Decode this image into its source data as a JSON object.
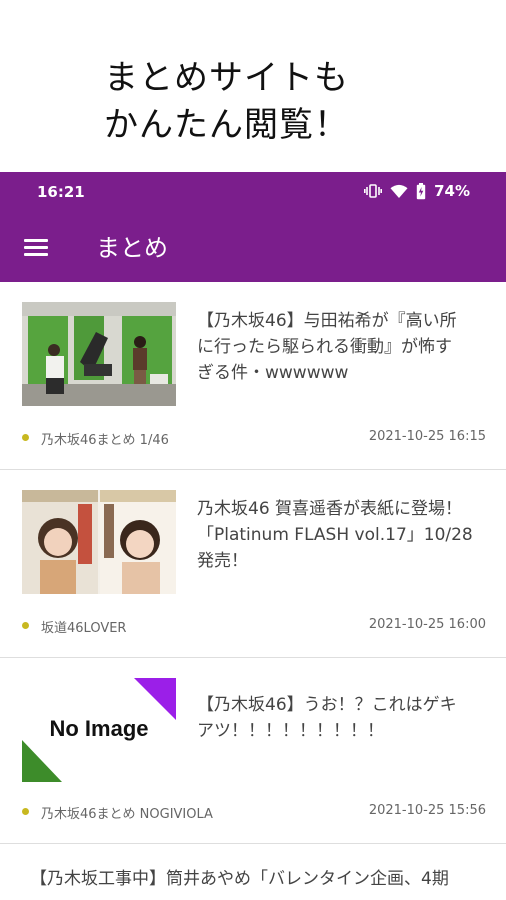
{
  "promo": {
    "line1": "まとめサイトも",
    "line2": "かんたん閲覧！"
  },
  "status_bar": {
    "time": "16:21",
    "battery": "74%",
    "icons": [
      "vibrate-icon",
      "wifi-icon",
      "battery-charging-icon"
    ]
  },
  "app_bar": {
    "title": "まとめ",
    "menu_icon": "hamburger-menu-icon"
  },
  "colors": {
    "primary": "#7b1e8c",
    "source_dot": "#c8b820"
  },
  "articles": [
    {
      "title_lines": [
        "【乃木坂46】与田祐希が『高い所",
        "に行ったら駆られる衝動』が怖す",
        "ぎる件・wwwwww"
      ],
      "source": "乃木坂46まとめ 1/46",
      "timestamp": "2021-10-25 16:15",
      "thumbnail": "photo"
    },
    {
      "title_lines": [
        "乃木坂46 賀喜遥香が表紙に登場！",
        "「Platinum FLASH vol.17」10/28",
        "発売！"
      ],
      "source": "坂道46LOVER",
      "timestamp": "2021-10-25 16:00",
      "thumbnail": "magazine-cover"
    },
    {
      "title_lines": [
        "【乃木坂46】うお！？これはゲキ",
        "アツ！！！！！！！！！"
      ],
      "source": "乃木坂46まとめ NOGIVIOLA",
      "timestamp": "2021-10-25 15:56",
      "thumbnail_text": "No Image"
    },
    {
      "title_lines": [
        "【乃木坂工事中】筒井あやめ「バレンタイン企画、4期"
      ]
    }
  ]
}
